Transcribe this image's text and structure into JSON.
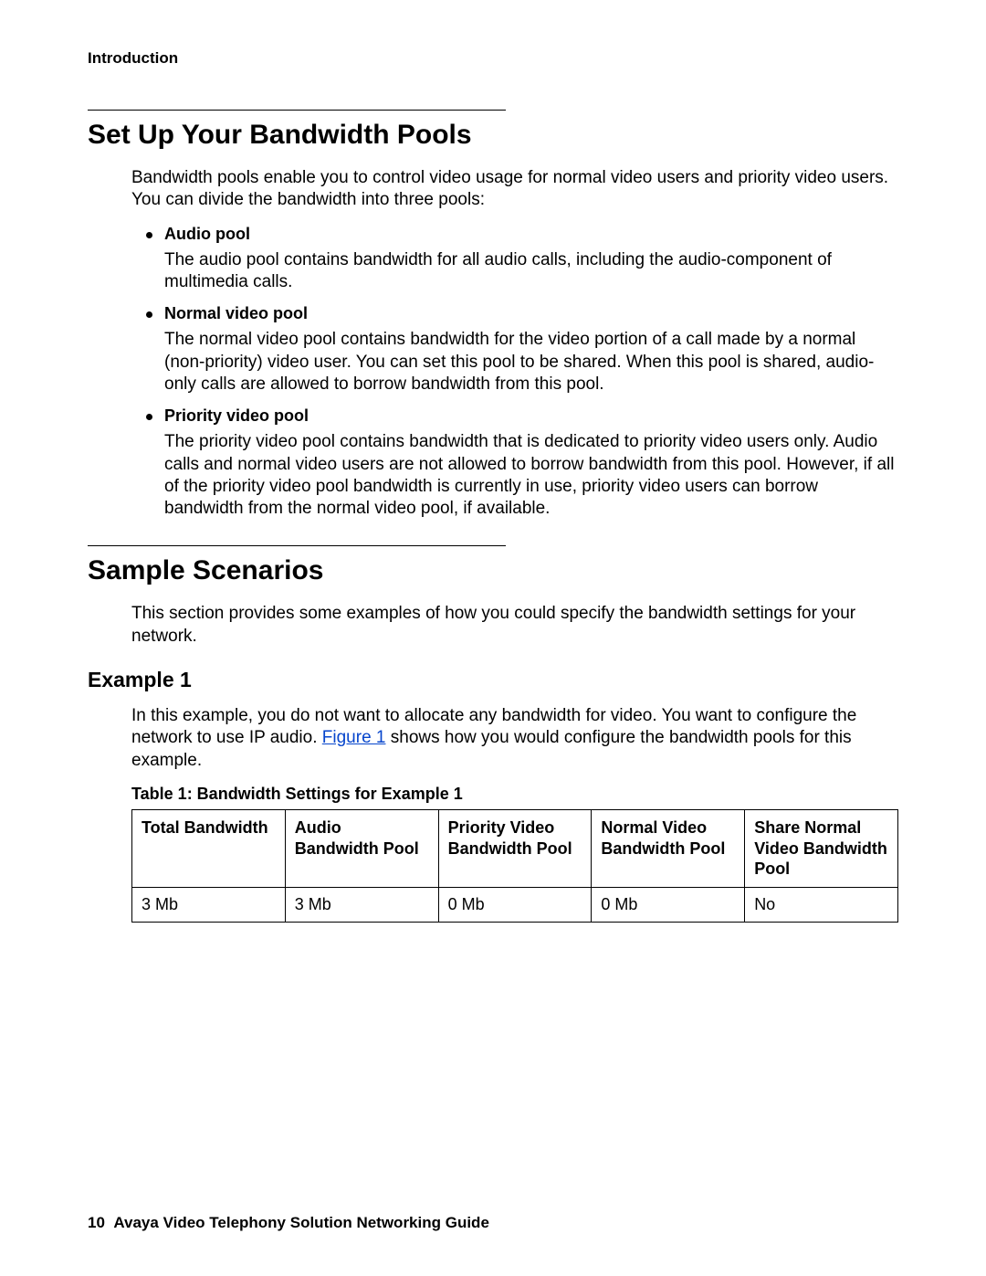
{
  "running_head": "Introduction",
  "section_bandwidth": {
    "title": "Set Up Your Bandwidth Pools",
    "intro": "Bandwidth pools enable you to control video usage for normal video users and priority video users. You can divide the bandwidth into three pools:",
    "pools": [
      {
        "name": "Audio pool",
        "desc": "The audio pool contains bandwidth for all audio calls, including the audio-component of multimedia calls."
      },
      {
        "name": "Normal video pool",
        "desc": "The normal video pool contains bandwidth for the video portion of a call made by a normal (non-priority) video user. You can set this pool to be shared. When this pool is shared, audio-only calls are allowed to borrow bandwidth from this pool."
      },
      {
        "name": "Priority video pool",
        "desc": "The priority video pool contains bandwidth that is dedicated to priority video users only. Audio calls and normal video users are not allowed to borrow bandwidth from this pool. However, if all of the priority video pool bandwidth is currently in use, priority video users can borrow bandwidth from the normal video pool, if available."
      }
    ]
  },
  "section_scenarios": {
    "title": "Sample Scenarios",
    "intro": "This section provides some examples of how you could specify the bandwidth settings for your network.",
    "example1": {
      "heading": "Example 1",
      "intro_before_link": "In this example, you do not want to allocate any bandwidth for video. You want to configure the network to use IP audio. ",
      "link_text": "Figure 1",
      "intro_after_link": " shows how you would configure the bandwidth pools for this example.",
      "table_caption": "Table 1: Bandwidth Settings for Example 1",
      "table": {
        "headers": [
          "Total Bandwidth",
          "Audio Bandwidth Pool",
          "Priority Video Bandwidth Pool",
          "Normal Video Bandwidth Pool",
          "Share Normal Video Bandwidth Pool"
        ],
        "rows": [
          [
            "3 Mb",
            "3 Mb",
            "0 Mb",
            "0 Mb",
            "No"
          ]
        ]
      }
    }
  },
  "chart_data": {
    "type": "table",
    "title": "Table 1: Bandwidth Settings for Example 1",
    "columns": [
      "Total Bandwidth",
      "Audio Bandwidth Pool",
      "Priority Video Bandwidth Pool",
      "Normal Video Bandwidth Pool",
      "Share Normal Video Bandwidth Pool"
    ],
    "rows": [
      [
        "3 Mb",
        "3 Mb",
        "0 Mb",
        "0 Mb",
        "No"
      ]
    ]
  },
  "footer": {
    "page_number": "10",
    "doc_title": "Avaya Video Telephony Solution Networking Guide"
  }
}
